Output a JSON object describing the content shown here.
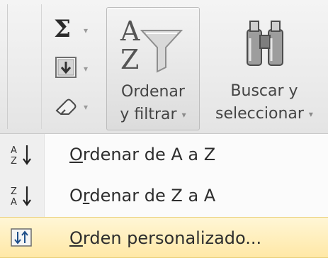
{
  "ribbon": {
    "autosum_icon": "sigma-icon",
    "fill_icon": "fill-down-icon",
    "clear_icon": "eraser-icon",
    "sort_filter": {
      "line1": "Ordenar",
      "line2": "y filtrar",
      "icon": "sort-filter-funnel-icon"
    },
    "find_select": {
      "line1": "Buscar y",
      "line2": "seleccionar",
      "icon": "binoculars-icon"
    },
    "dropdown_glyph": "▾"
  },
  "menu": {
    "items": [
      {
        "pre": "",
        "key": "O",
        "rest": "rdenar de A a Z",
        "icon": "sort-a-to-z-icon"
      },
      {
        "pre": "O",
        "key": "r",
        "rest": "denar de Z a A",
        "icon": "sort-z-to-a-icon"
      },
      {
        "pre": "",
        "key": "O",
        "rest": "rden personalizado...",
        "icon": "custom-sort-icon"
      }
    ]
  },
  "colors": {
    "highlight_top": "#fff6d6",
    "highlight_bottom": "#ffe8a6",
    "ribbon_bg": "#ebebeb"
  }
}
